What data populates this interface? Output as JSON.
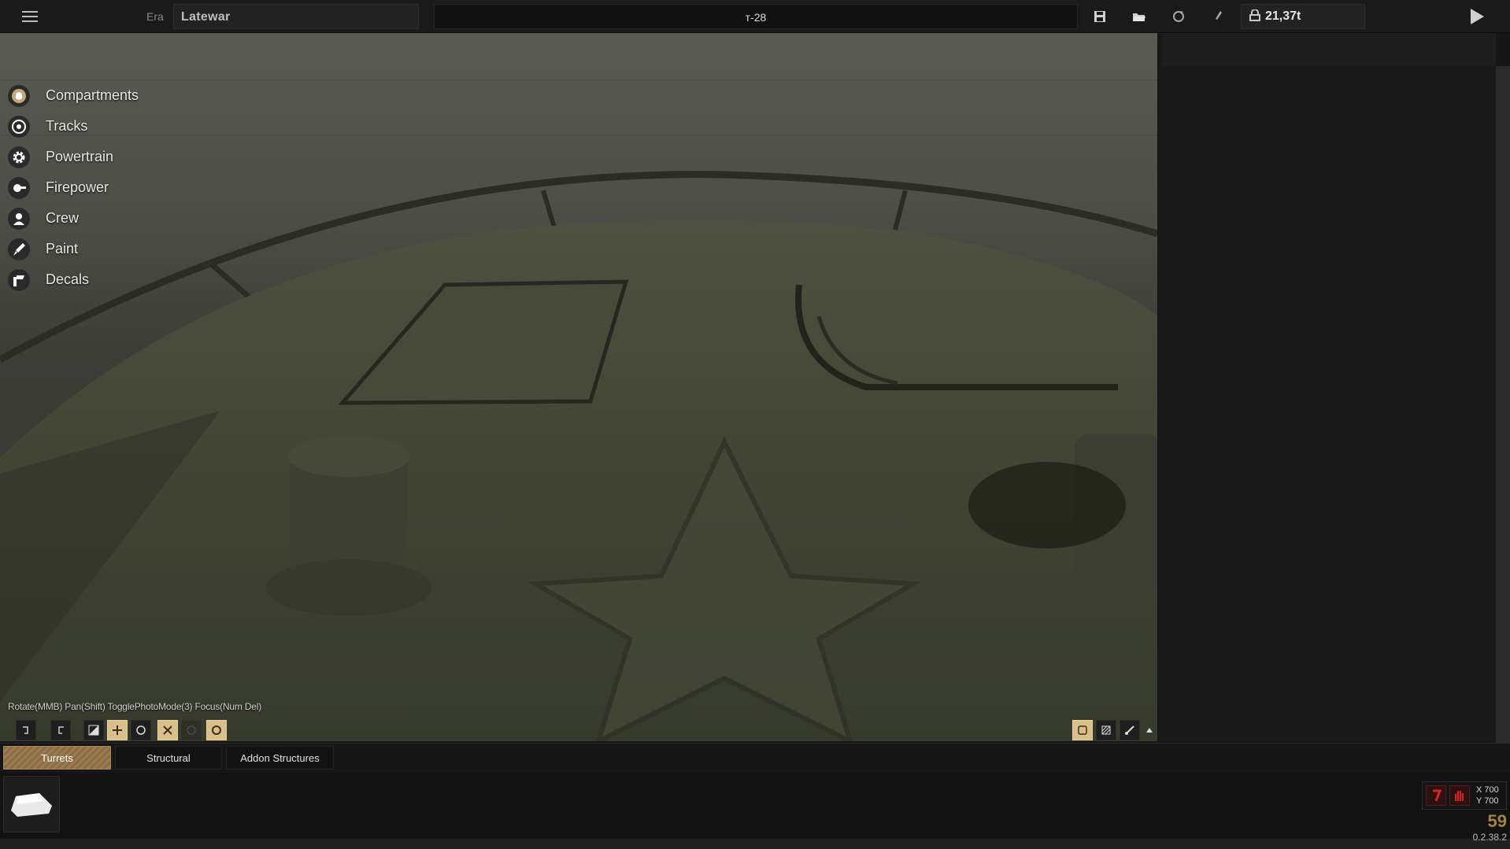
{
  "topbar": {
    "era_label": "Era",
    "era_value": "Latewar",
    "vehicle_name": "т-28",
    "weight": "21,37t",
    "icons": [
      "menu-icon",
      "save-icon",
      "load-icon",
      "reset-icon",
      "brush-icon",
      "lock-icon",
      "play-icon"
    ]
  },
  "sidebar": {
    "items": [
      {
        "label": "Compartments",
        "icon": "cube-icon"
      },
      {
        "label": "Tracks",
        "icon": "track-wheel-icon"
      },
      {
        "label": "Powertrain",
        "icon": "gear-icon"
      },
      {
        "label": "Firepower",
        "icon": "gun-icon"
      },
      {
        "label": "Crew",
        "icon": "person-icon"
      },
      {
        "label": "Paint",
        "icon": "paint-brush-icon"
      },
      {
        "label": "Decals",
        "icon": "decal-icon"
      }
    ]
  },
  "viewport": {
    "hint": "Rotate(MMB) Pan(Shift) TogglePhotoMode(3) Focus(Num Del)"
  },
  "bottom": {
    "tabs": [
      {
        "label": "Turrets",
        "active": true
      },
      {
        "label": "Structural",
        "active": false
      },
      {
        "label": "Addon Structures",
        "active": false
      }
    ]
  },
  "status": {
    "coord_x": "X 700",
    "coord_y": "Y 700",
    "fps": "59",
    "version": "0.2.38.2",
    "colors": {
      "accent": "#d9bf8a",
      "fps": "#a2863a",
      "warning": "#e02020"
    }
  }
}
